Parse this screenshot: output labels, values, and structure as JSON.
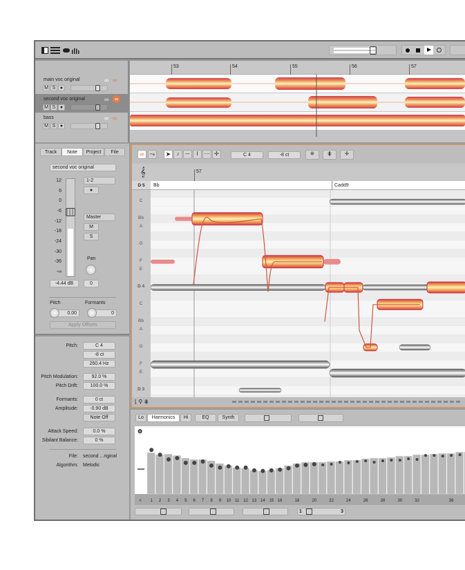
{
  "toolbar": {
    "icons": [
      "inspector-toggle-icon",
      "track-list-icon",
      "blobs-icon",
      "spectrum-icon"
    ],
    "transport": [
      "record",
      "stop",
      "play",
      "loop"
    ]
  },
  "ruler": {
    "bars": [
      "53",
      "54",
      "55",
      "56",
      "57"
    ]
  },
  "tracks": [
    {
      "name": "main voc original",
      "m": "M",
      "s": "S",
      "selected": false
    },
    {
      "name": "second voc original",
      "m": "M",
      "s": "S",
      "selected": true
    },
    {
      "name": "bass",
      "m": "M",
      "s": "S",
      "selected": false
    }
  ],
  "inspector": {
    "tabs": [
      "Track",
      "Note",
      "Project",
      "File"
    ],
    "track_name": "second voc original",
    "meter_scale": [
      "12",
      "6",
      "0",
      "-6",
      "-12",
      "-18",
      "-24",
      "-30",
      "-36",
      "-∞"
    ],
    "input": "1-2",
    "output": "Master",
    "mute": "M",
    "solo": "S",
    "pan_label": "Pan",
    "volume": "-4.44 dB",
    "pan": "0",
    "pitch_label": "Pitch",
    "pitch_value": "0.00",
    "formants_label": "Formants",
    "formants_value": "0",
    "apply": "Apply Offsets"
  },
  "note": {
    "pitch_label": "Pitch:",
    "pitch": "C 4",
    "cents": "-8 ct",
    "hz": "260.4 Hz",
    "mod_label": "Pitch Modulation:",
    "mod": "92.0 %",
    "drift_label": "Pitch Drift:",
    "drift": "100.0 %",
    "formants_label": "Formants:",
    "formants": "0 ct",
    "amp_label": "Amplitude:",
    "amp": "-0.90 dB",
    "note_off": "Note Off",
    "attack_label": "Attack Speed:",
    "attack": "0.0 %",
    "sib_label": "Sibilant Balance:",
    "sib": "0 %",
    "file_label": "File:",
    "file": "second ...riginal",
    "algo_label": "Algorithm:",
    "algo": "Melodic"
  },
  "editor": {
    "pitch": "C 4",
    "cents": "-8 ct",
    "bar": "57",
    "chords": [
      "Bb",
      "Cadd9"
    ],
    "top_note": "D 5",
    "keys": [
      {
        "l": "C",
        "s": 10
      },
      {
        "l": "Bb",
        "s": 8
      },
      {
        "l": "A",
        "s": 7
      },
      {
        "l": "G",
        "s": 5
      },
      {
        "l": "F",
        "s": 3
      },
      {
        "l": "E",
        "s": 2
      },
      {
        "l": "D 4",
        "s": 0
      },
      {
        "l": "C",
        "s": -2
      },
      {
        "l": "Bb",
        "s": -4
      },
      {
        "l": "A",
        "s": -5
      },
      {
        "l": "G",
        "s": -7
      },
      {
        "l": "F",
        "s": -9
      },
      {
        "l": "E",
        "s": -10
      },
      {
        "l": "D 3",
        "s": -12
      }
    ]
  },
  "sound": {
    "tabs": [
      "Lo",
      "Harmonics",
      "Hi",
      "EQ",
      "Synth"
    ],
    "harmonic_labels": [
      "<",
      "1",
      "2",
      "3",
      "4",
      "5",
      "6",
      "7",
      "8",
      "9",
      "10",
      "11",
      "12",
      "13",
      "14",
      "15",
      "16",
      "18",
      "20",
      "22",
      "24",
      "26",
      "28",
      "30",
      "32",
      "36"
    ],
    "levels": [
      0.61,
      0.58,
      0.59,
      0.57,
      0.53,
      0.51,
      0.51,
      0.49,
      0.45,
      0.42,
      0.39,
      0.38,
      0.35,
      0.34,
      0.35,
      0.38,
      0.42,
      0.45,
      0.47,
      0.47,
      0.47,
      0.48,
      0.48,
      0.5,
      0.5,
      0.52,
      0.53,
      0.53,
      0.54,
      0.56,
      0.56,
      0.58,
      0.58,
      0.59,
      0.6,
      0.6,
      0.62,
      0.62
    ],
    "dots": [
      0.65,
      0.58,
      0.51,
      0.53,
      0.46,
      0.46,
      0.48,
      0.42,
      0.39,
      0.41,
      0.39,
      0.39,
      0.35,
      0.34,
      0.35,
      0.36,
      0.38,
      0.42,
      0.43,
      0.44,
      0.43,
      0.44,
      0.47,
      0.46,
      0.48,
      0.49,
      0.47,
      0.49,
      0.5,
      0.5,
      0.52,
      0.51,
      0.57,
      0.57,
      0.56,
      0.57,
      0.58,
      0.57
    ],
    "bottom_values": [
      "1",
      "3"
    ]
  },
  "colors": {
    "accent": "#e0583a",
    "blob_core": "#fbe9a6",
    "blob_edge": "#d23a4a",
    "panel": "#bdbdbd"
  }
}
